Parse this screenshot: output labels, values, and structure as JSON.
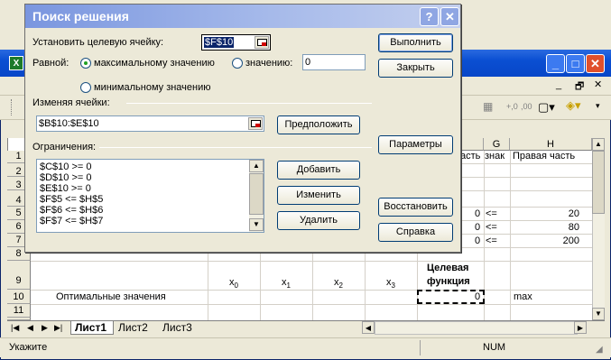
{
  "excel": {
    "menu_items": [],
    "column_headers": [
      "G",
      "H"
    ],
    "visible_header_fragments": {
      "F": "асть",
      "G": "знак",
      "H": "Правая часть"
    },
    "row_numbers": [
      "1",
      "2",
      "3",
      "4",
      "5",
      "6",
      "7",
      "8",
      "9",
      "10",
      "11",
      "12"
    ],
    "rows": {
      "r5": {
        "f": "0",
        "g": "<=",
        "h": "20"
      },
      "r6": {
        "f": "0",
        "g": "<=",
        "h": "80"
      },
      "r7": {
        "f": "0",
        "g": "<=",
        "h": "200"
      },
      "r9": {
        "x0": "x0",
        "x1": "x1",
        "x2": "x2",
        "x3": "x3",
        "target_line1": "Целевая",
        "target_line2": "функция"
      },
      "r10": {
        "label": "Оптимальные значения",
        "f": "0",
        "g": "max"
      }
    },
    "sheet_tabs": [
      "Лист1",
      "Лист2",
      "Лист3"
    ],
    "active_tab": "Лист1",
    "status_left": "Укажите",
    "status_num": "NUM"
  },
  "dialog": {
    "title": "Поиск решения",
    "target_cell_label": "Установить целевую ячейку:",
    "target_cell_value": "$F$10",
    "equal_label": "Равной:",
    "radio_max": "максимальному значению",
    "radio_value": "значению:",
    "value_field": "0",
    "radio_min": "минимальному значению",
    "changing_cells_label": "Изменяя ячейки:",
    "changing_cells_value": "$B$10:$E$10",
    "guess_button": "Предположить",
    "constraints_label": "Ограничения:",
    "constraints": [
      "$C$10 >= 0",
      "$D$10 >= 0",
      "$E$10 >= 0",
      "$F$5 <= $H$5",
      "$F$6 <= $H$6",
      "$F$7 <= $H$7"
    ],
    "add_button": "Добавить",
    "change_button": "Изменить",
    "delete_button": "Удалить",
    "solve_button": "Выполнить",
    "close_button": "Закрыть",
    "options_button": "Параметры",
    "reset_button": "Восстановить",
    "help_button": "Справка"
  },
  "colors": {
    "accent": "#0a4fd2",
    "dialog_title": "#a5b9ea"
  }
}
